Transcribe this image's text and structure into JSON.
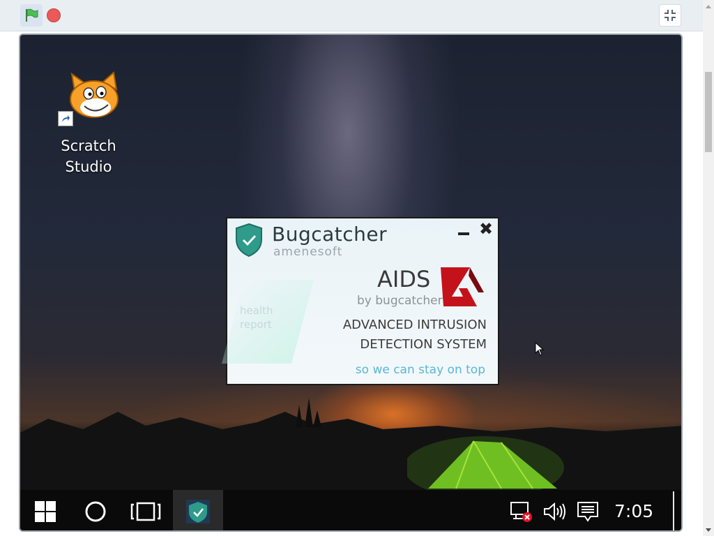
{
  "player": {
    "green_flag": "green-flag-icon",
    "stop": "stop-icon",
    "fullscreen": "exit-fullscreen-icon"
  },
  "desktop": {
    "icon_label_line1": "Scratch",
    "icon_label_line2": "Studio"
  },
  "popup": {
    "brand": "Bugcatcher",
    "vendor": "amenesoft",
    "product": "AIDS",
    "by": "by bugcatcher",
    "headline_line1": "ADVANCED INTRUSION",
    "headline_line2": "DETECTION SYSTEM",
    "tagline": "so we can stay on top",
    "health_line1": "health",
    "health_line2": "report"
  },
  "taskbar": {
    "start": "windows-start-icon",
    "search": "cortana-circle-icon",
    "task_view": "task-view-icon",
    "active_app": "bugcatcher-shield-icon",
    "network": "network-disconnected-icon",
    "volume": "volume-icon",
    "notifications": "action-center-icon",
    "clock": "7:05"
  },
  "colors": {
    "accent_blue": "#76b9ed",
    "shield_teal": "#2e9b8b",
    "logo_red": "#c4121a"
  }
}
